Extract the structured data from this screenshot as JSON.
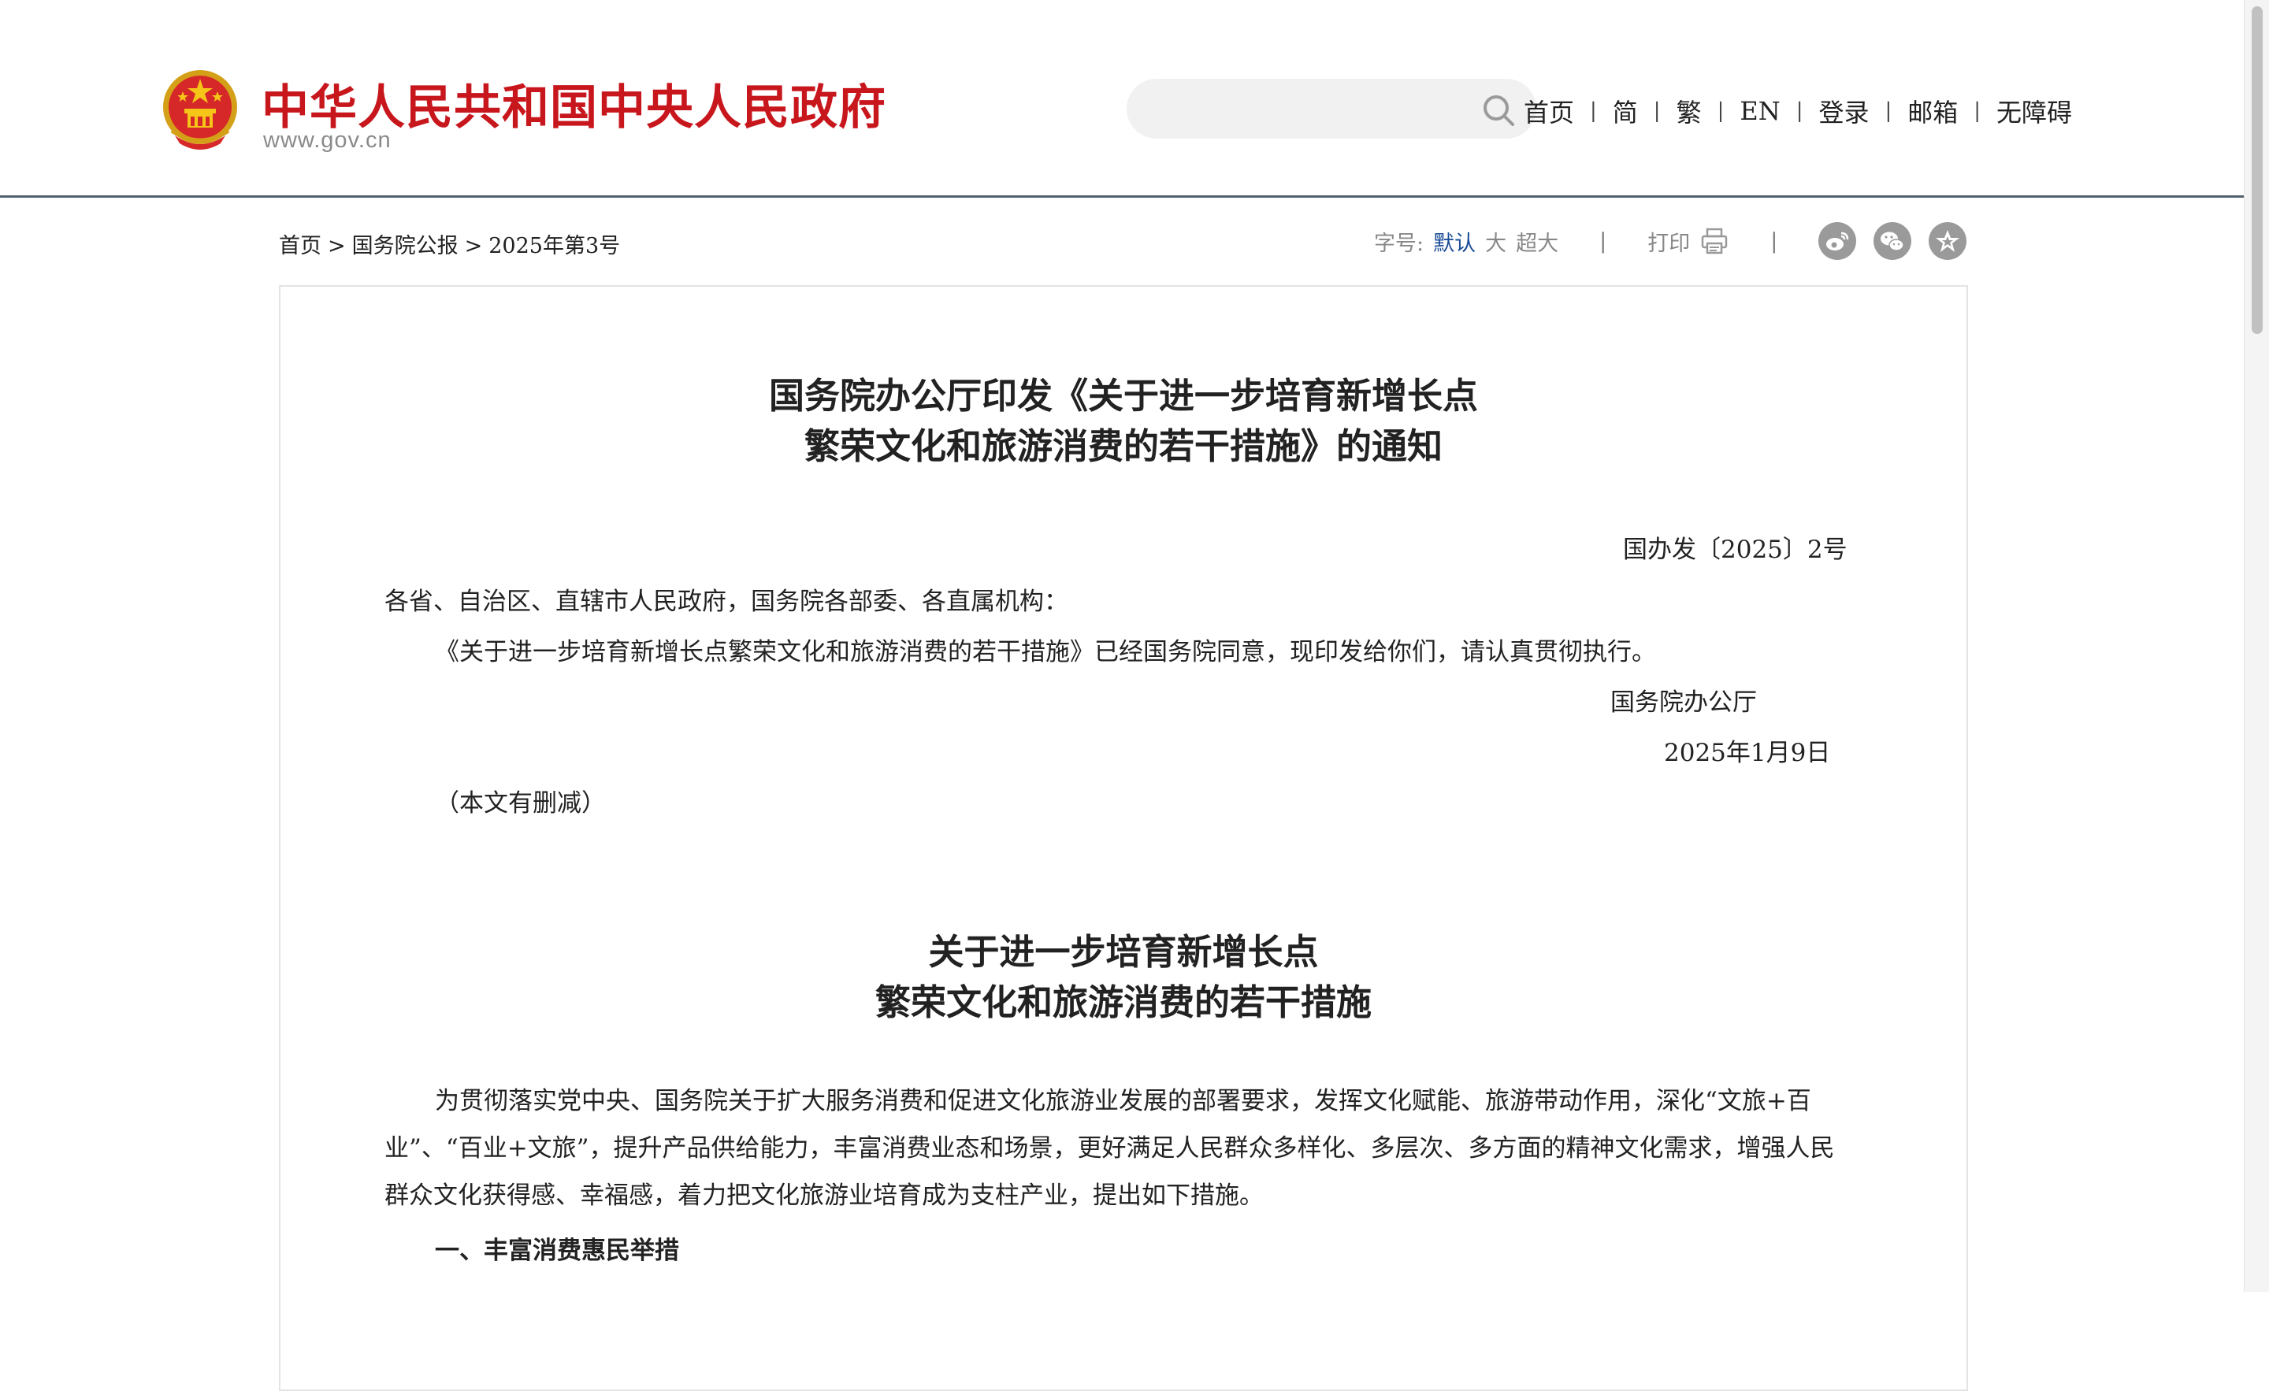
{
  "header": {
    "site_title": "中华人民共和国中央人民政府",
    "site_url": "www.gov.cn",
    "search": {
      "placeholder": ""
    },
    "nav": [
      "首页",
      "简",
      "繁",
      "EN",
      "登录",
      "邮箱",
      "无障碍"
    ],
    "colors": {
      "title_red": "#c8161d",
      "divider": "#51616d"
    },
    "icons": {
      "emblem": "national-emblem-icon",
      "search": "search-icon"
    }
  },
  "breadcrumb": {
    "items": [
      "首页",
      "国务院公报",
      "2025年第3号"
    ],
    "separator": ">"
  },
  "tools": {
    "font_size_label": "字号:",
    "font_options": [
      "默认",
      "大",
      "超大"
    ],
    "active_font_option": "默认",
    "print_label": "打印",
    "separator": "|",
    "icons": [
      "printer-icon",
      "weibo-icon",
      "wechat-icon",
      "favorite-star-icon"
    ],
    "colors": {
      "active": "#1a4d96",
      "muted": "#888888"
    }
  },
  "article": {
    "title_line1": "国务院办公厅印发《关于进一步培育新增长点",
    "title_line2": "繁荣文化和旅游消费的若干措施》的通知",
    "doc_number": "国办发〔2025〕2号",
    "salutation": "各省、自治区、直辖市人民政府，国务院各部委、各直属机构：",
    "notice_body": "《关于进一步培育新增长点繁荣文化和旅游消费的若干措施》已经国务院同意，现印发给你们，请认真贯彻执行。",
    "issuer": "国务院办公厅",
    "date": "2025年1月9日",
    "note": "（本文有删减）",
    "sub_title_line1": "关于进一步培育新增长点",
    "sub_title_line2": "繁荣文化和旅游消费的若干措施",
    "intro_paragraph": "为贯彻落实党中央、国务院关于扩大服务消费和促进文化旅游业发展的部署要求，发挥文化赋能、旅游带动作用，深化“文旅+百业”、“百业+文旅”，提升产品供给能力，丰富消费业态和场景，更好满足人民群众多样化、多层次、多方面的精神文化需求，增强人民群众文化获得感、幸福感，着力把文化旅游业培育成为支柱产业，提出如下措施。",
    "section1_heading": "一、丰富消费惠民举措"
  }
}
